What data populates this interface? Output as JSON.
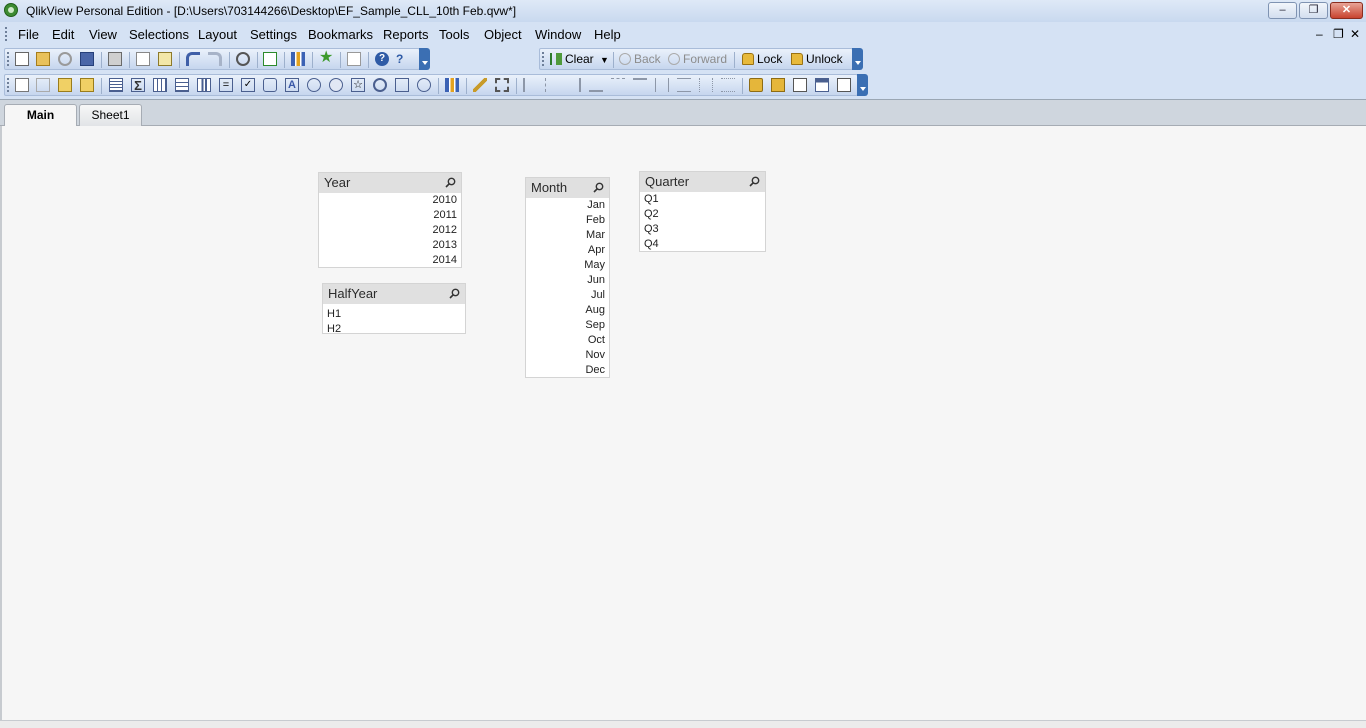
{
  "window": {
    "title": "QlikView Personal Edition - [D:\\Users\\703144266\\Desktop\\EF_Sample_CLL_10th Feb.qvw*]",
    "controls": {
      "minimize": "‒",
      "restore": "❐",
      "close": "✕"
    }
  },
  "menu": {
    "items": [
      "File",
      "Edit",
      "View",
      "Selections",
      "Layout",
      "Settings",
      "Bookmarks",
      "Reports",
      "Tools",
      "Object",
      "Window",
      "Help"
    ],
    "mdi": {
      "minimize": "‒",
      "restore": "❐",
      "close": "✕"
    }
  },
  "nav_toolbar": {
    "clear": "Clear",
    "back": "Back",
    "forward": "Forward",
    "lock": "Lock",
    "unlock": "Unlock"
  },
  "tabs": {
    "main": "Main",
    "sheet1": "Sheet1"
  },
  "listboxes": {
    "year": {
      "title": "Year",
      "values": [
        "2010",
        "2011",
        "2012",
        "2013",
        "2014"
      ]
    },
    "halfyear": {
      "title": "HalfYear",
      "values": [
        "H1",
        "H2"
      ]
    },
    "month": {
      "title": "Month",
      "values": [
        "Jan",
        "Feb",
        "Mar",
        "Apr",
        "May",
        "Jun",
        "Jul",
        "Aug",
        "Sep",
        "Oct",
        "Nov",
        "Dec"
      ]
    },
    "quarter": {
      "title": "Quarter",
      "values": [
        "Q1",
        "Q2",
        "Q3",
        "Q4"
      ]
    }
  },
  "colors": {
    "toolbar_bg": "#d5e2f4",
    "sheet_bg": "#f6f6f6",
    "caption_bg": "#e0e0e0"
  }
}
